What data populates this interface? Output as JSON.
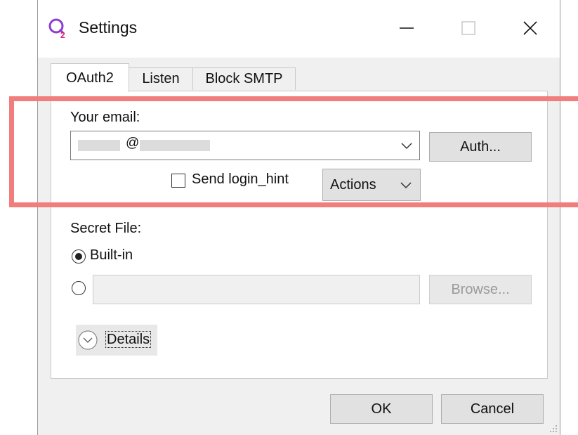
{
  "window": {
    "title": "Settings"
  },
  "tabs": [
    {
      "label": "OAuth2",
      "active": true
    },
    {
      "label": "Listen",
      "active": false
    },
    {
      "label": "Block SMTP",
      "active": false
    }
  ],
  "oauth2": {
    "email_label": "Your email:",
    "email_value_visible": "@",
    "auth_button": "Auth...",
    "send_login_hint_label": "Send login_hint",
    "send_login_hint_checked": false,
    "actions_label": "Actions",
    "secret_file_label": "Secret File:",
    "builtin_label": "Built-in",
    "builtin_selected": true,
    "custom_path_value": "",
    "browse_button": "Browse...",
    "details_label": "Details"
  },
  "footer": {
    "ok": "OK",
    "cancel": "Cancel"
  },
  "colors": {
    "highlight": "#f27d7d",
    "window_bg": "#f0f0f0",
    "app_icon": "#8a3fd1"
  }
}
